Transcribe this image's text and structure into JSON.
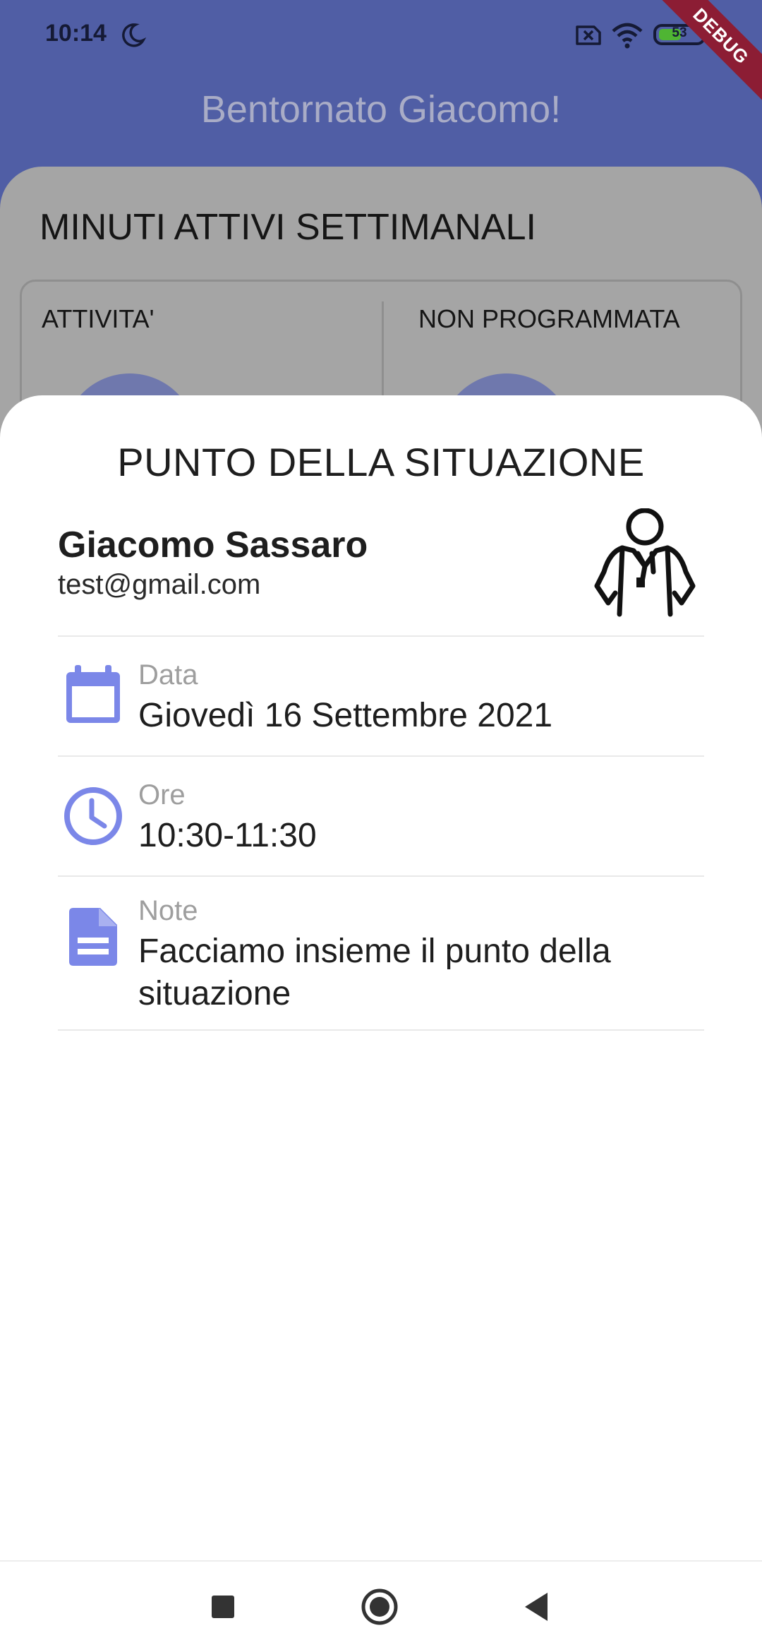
{
  "status_bar": {
    "time": "10:14",
    "battery": "53",
    "battery_level": 0.53,
    "icons": [
      "moon-icon",
      "sim-off-icon",
      "wifi-icon",
      "battery-icon"
    ]
  },
  "debug_banner": "DEBUG",
  "app_bar": {
    "title": "Bentornato Giacomo!"
  },
  "background": {
    "heading": "MINUTI ATTIVI SETTIMANALI",
    "columns": [
      "ATTIVITA'",
      "NON PROGRAMMATA"
    ]
  },
  "sheet": {
    "title": "PUNTO DELLA SITUAZIONE",
    "user": {
      "name": "Giacomo Sassaro",
      "email": "test@gmail.com",
      "avatar_icon": "doctor-icon"
    },
    "details": [
      {
        "icon": "calendar-icon",
        "label": "Data",
        "value": "Giovedì 16 Settembre 2021"
      },
      {
        "icon": "clock-icon",
        "label": "Ore",
        "value": "10:30-11:30"
      },
      {
        "icon": "note-icon",
        "label": "Note",
        "value": "Facciamo insieme il punto della situazione"
      }
    ]
  },
  "nav_bar": {
    "buttons": [
      "recents-button",
      "home-button",
      "back-button"
    ]
  },
  "colors": {
    "accent": "#7b87e8",
    "app_bar": "#505ea5",
    "scrim_sheet": "#a5a5a5",
    "debug": "#8c1d34"
  }
}
